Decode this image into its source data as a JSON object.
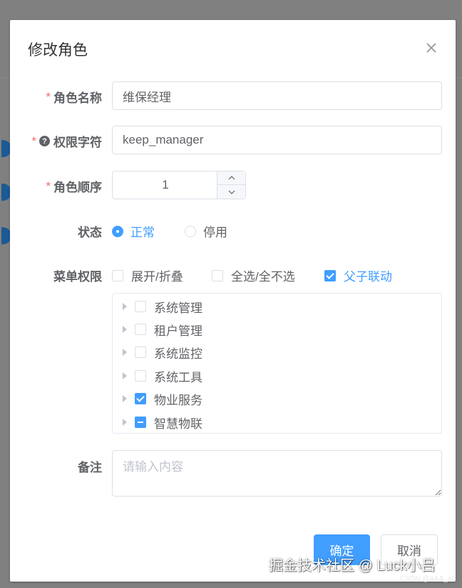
{
  "dialog": {
    "title": "修改角色",
    "close_icon": "close-icon"
  },
  "form": {
    "role_name": {
      "label": "角色名称",
      "required": "*",
      "value": "维保经理"
    },
    "permission_key": {
      "label": "权限字符",
      "required": "*",
      "help_icon": "?",
      "value": "keep_manager"
    },
    "role_order": {
      "label": "角色顺序",
      "required": "*",
      "value": "1"
    },
    "status": {
      "label": "状态",
      "options": [
        {
          "label": "正常",
          "selected": true
        },
        {
          "label": "停用",
          "selected": false
        }
      ]
    },
    "menu_permission": {
      "label": "菜单权限",
      "options": [
        {
          "label": "展开/折叠",
          "checked": false
        },
        {
          "label": "全选/全不选",
          "checked": false
        },
        {
          "label": "父子联动",
          "checked": true
        }
      ],
      "tree": [
        {
          "label": "系统管理",
          "state": "unchecked"
        },
        {
          "label": "租户管理",
          "state": "unchecked"
        },
        {
          "label": "系统监控",
          "state": "unchecked"
        },
        {
          "label": "系统工具",
          "state": "unchecked"
        },
        {
          "label": "物业服务",
          "state": "checked"
        },
        {
          "label": "智慧物联",
          "state": "indeterminate"
        }
      ]
    },
    "remark": {
      "label": "备注",
      "placeholder": "请输入内容",
      "value": ""
    }
  },
  "footer": {
    "confirm_label": "确定",
    "cancel_label": "取消"
  },
  "watermark": {
    "main": "掘金技术社区 @ Luck小吕",
    "small": "CSDN @AAA_a2"
  },
  "colors": {
    "primary": "#409eff",
    "required": "#f56c6c",
    "text": "#606266",
    "title": "#303133",
    "border": "#dcdfe6"
  }
}
